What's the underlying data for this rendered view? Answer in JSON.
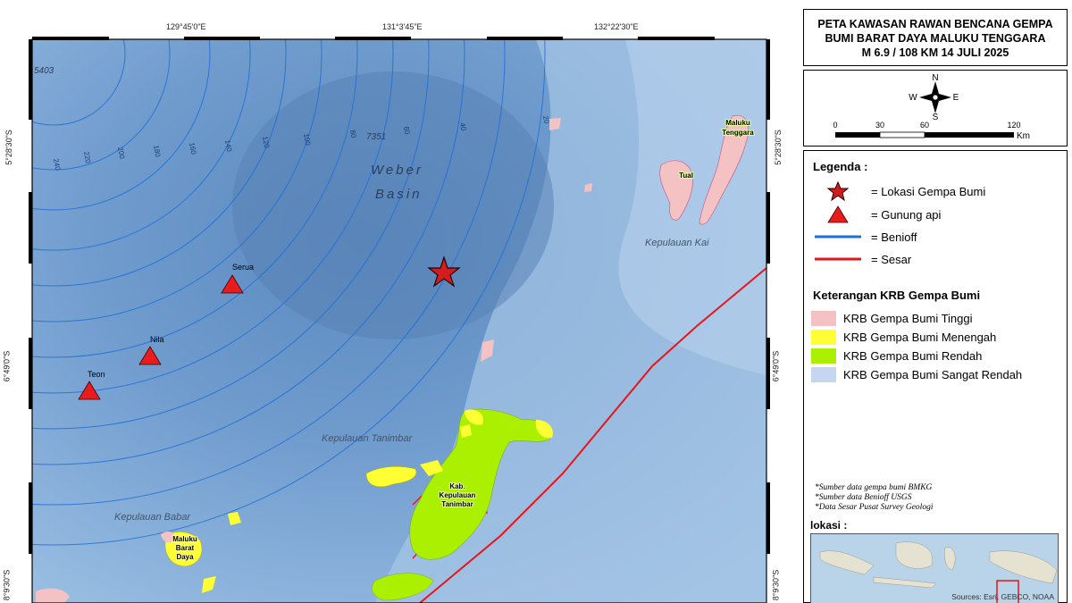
{
  "title": {
    "line1": "PETA KAWASAN RAWAN BENCANA GEMPA",
    "line2": "BUMI BARAT DAYA MALUKU TENGGARA",
    "line3": "M 6.9 / 108 KM  14 JULI 2025"
  },
  "coords": {
    "top": [
      "129°45'0\"E",
      "131°3'45\"E",
      "132°22'30\"E"
    ],
    "side": [
      "5°28'30\"S",
      "6°49'0\"S",
      "8°9'30\"S"
    ]
  },
  "compass": {
    "n": "N",
    "s": "S",
    "e": "E",
    "w": "W"
  },
  "scale": {
    "ticks": [
      "0",
      "30",
      "60",
      "120"
    ],
    "unit": "Km"
  },
  "legend": {
    "title": "Legenda :",
    "items": [
      {
        "label": "= Lokasi Gempa Bumi"
      },
      {
        "label": "= Gunung api"
      },
      {
        "label": "= Benioff"
      },
      {
        "label": "= Sesar"
      }
    ]
  },
  "krb": {
    "title": "Keterangan KRB Gempa Bumi",
    "items": [
      {
        "label": "KRB Gempa Bumi Tinggi",
        "color": "#f4c2c2"
      },
      {
        "label": "KRB Gempa Bumi  Menengah",
        "color": "#ffff33"
      },
      {
        "label": "KRB Gempa Bumi Rendah",
        "color": "#aaf000"
      },
      {
        "label": "KRB Gempa Bumi Sangat Rendah",
        "color": "#c5d6f0"
      }
    ]
  },
  "notes": [
    "*Sumber data gempa bumi BMKG",
    "*Sumber data Benioff USGS",
    "*Data Sesar Pusat Survey Geologi"
  ],
  "lokasi": "lokasi :",
  "sources": "Sources: Esri, GEBCO, NOAA",
  "map": {
    "basin": [
      "Weber",
      "Basin"
    ],
    "depth_labels": [
      "5403",
      "7351"
    ],
    "contour_labels": [
      "240",
      "220",
      "200",
      "180",
      "160",
      "140",
      "120",
      "100",
      "80",
      "60",
      "40",
      "20"
    ],
    "volcanoes": [
      "Serua",
      "Nila",
      "Teon"
    ],
    "places": {
      "kai": "Kepulauan Kai",
      "tanimbar": "Kepulauan Tanimbar",
      "babar": "Kepulauan Babar",
      "maluku_tenggara": [
        "Maluku",
        "Tenggara"
      ],
      "tual": "Tual",
      "kab_tanimbar": [
        "Kab.",
        "Kepulauan",
        "Tanimbar"
      ],
      "mbd": [
        "Maluku",
        "Barat",
        "Daya"
      ]
    }
  },
  "colors": {
    "sea": "#7ea9d6",
    "deep_sea": "#5a86bc",
    "benioff": "#1f6fd8",
    "fault": "#e8141b",
    "epicenter": "#d31d1d",
    "volcano": "#e81c1c"
  }
}
